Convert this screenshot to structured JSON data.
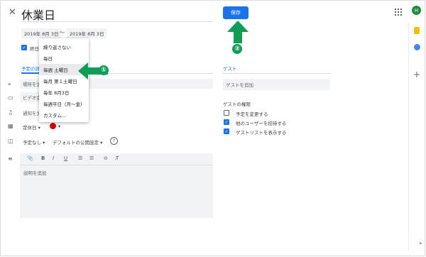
{
  "header": {
    "close_glyph": "✕",
    "title": "休業日",
    "save_label": "保存",
    "avatar_initial": "H"
  },
  "dates": {
    "start": "2019年 8月 3日",
    "separator": "〜",
    "end": "2019年 8月 3日"
  },
  "allday": {
    "label": "終日",
    "checked": true
  },
  "tabs": {
    "details": "予定の詳細",
    "guests": "ゲスト"
  },
  "repeat_menu": {
    "items": [
      {
        "label": "繰り返さない"
      },
      {
        "label": "毎日"
      },
      {
        "label": "毎週 土曜日",
        "selected": true
      },
      {
        "label": "毎月 第１土曜日"
      },
      {
        "label": "毎年 8月3日"
      },
      {
        "label": "毎週平日（月〜金）"
      },
      {
        "label": "カスタム..."
      }
    ]
  },
  "details": {
    "location_placeholder": "場所を追加",
    "video_label": "ビデオ会",
    "notification_label": "通知を追加",
    "calendar_label": "定休日",
    "calendar_color": "#d50000",
    "availability": "予定なし",
    "visibility": "デフォルトの公開設定",
    "help_glyph": "?",
    "description_placeholder": "説明を追加"
  },
  "toolbar": {
    "attach": "📎",
    "bold": "B",
    "italic": "I",
    "underline": "U",
    "numbered": "☰",
    "bulleted": "☰",
    "link": "⊖",
    "clear": "T̸"
  },
  "guests": {
    "add_placeholder": "ゲストを追加",
    "permissions_title": "ゲストの権限",
    "permissions": [
      {
        "label": "予定を変更する",
        "checked": false
      },
      {
        "label": "他のユーザーを招待する",
        "checked": true
      },
      {
        "label": "ゲストリストを表示する",
        "checked": true
      }
    ]
  },
  "annotations": {
    "one": "①",
    "two": "②"
  },
  "colors": {
    "accent": "#1a73e8",
    "annotation": "#0f9d58"
  }
}
